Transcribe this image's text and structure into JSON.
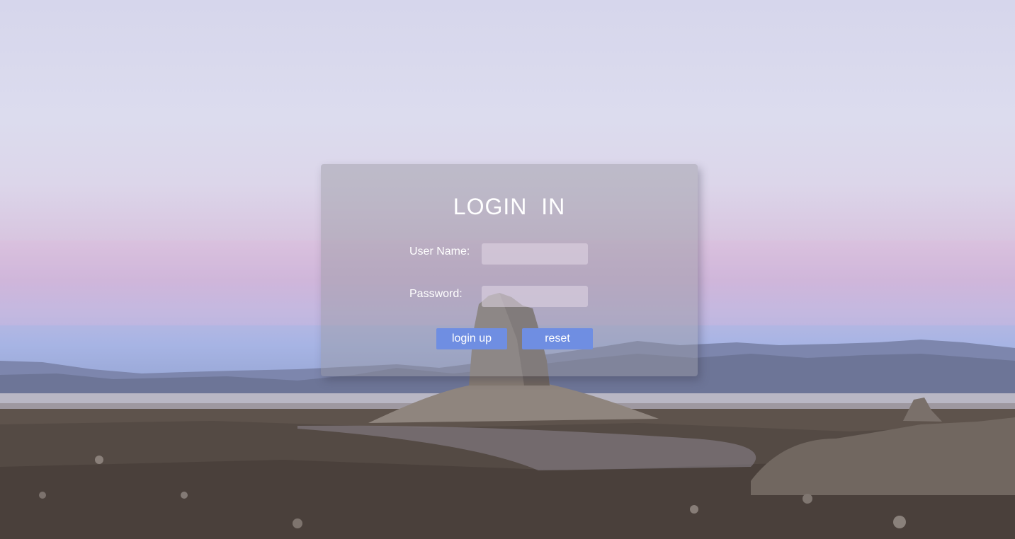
{
  "login": {
    "title": "LOGIN   IN",
    "username_label": "User Name:",
    "username_value": "",
    "password_label": "Password:",
    "password_value": "",
    "login_button": "login up",
    "reset_button": "reset"
  },
  "colors": {
    "button": "#6f8ee2",
    "panel": "#96969f",
    "text": "#ffffff"
  }
}
